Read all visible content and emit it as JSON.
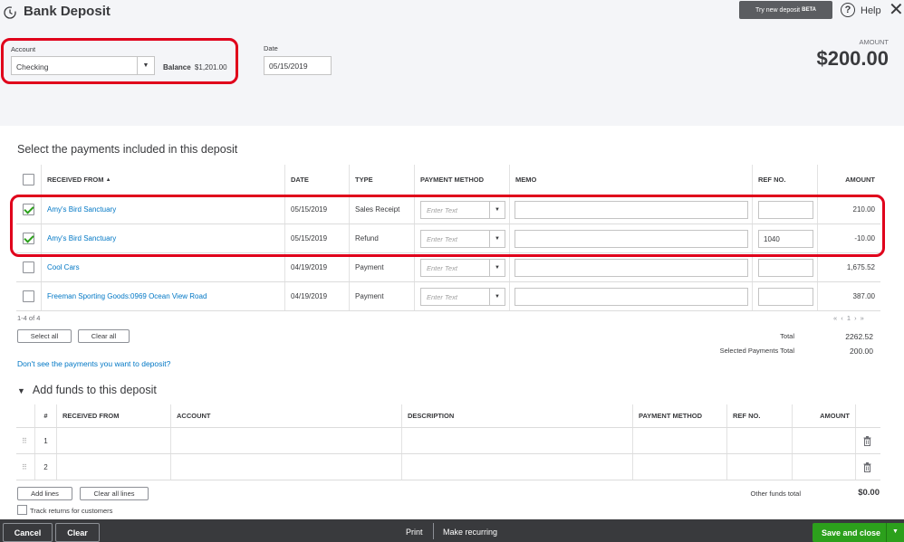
{
  "header": {
    "title": "Bank Deposit",
    "beta_button": "Try new deposit",
    "beta_badge": "BETA",
    "help": "Help",
    "account_label": "Account",
    "account_value": "Checking",
    "balance_label": "Balance",
    "balance_value": "$1,201.00",
    "date_label": "Date",
    "date_value": "05/15/2019",
    "amount_label": "AMOUNT",
    "amount_value": "$200.00"
  },
  "payments": {
    "title": "Select the payments included in this deposit",
    "columns": {
      "received_from": "RECEIVED FROM",
      "sort": "▲",
      "date": "DATE",
      "type": "TYPE",
      "payment_method": "PAYMENT METHOD",
      "memo": "MEMO",
      "ref_no": "REF NO.",
      "amount": "AMOUNT"
    },
    "placeholder": "Enter Text",
    "rows": [
      {
        "name": "Amy's Bird Sanctuary",
        "date": "05/15/2019",
        "type": "Sales Receipt",
        "ref": "",
        "amount": "210.00",
        "checked": true
      },
      {
        "name": "Amy's Bird Sanctuary",
        "date": "05/15/2019",
        "type": "Refund",
        "ref": "1040",
        "amount": "-10.00",
        "checked": true
      },
      {
        "name": "Cool Cars",
        "date": "04/19/2019",
        "type": "Payment",
        "ref": "",
        "amount": "1,675.52",
        "checked": false
      },
      {
        "name": "Freeman Sporting Goods:0969 Ocean View Road",
        "date": "04/19/2019",
        "type": "Payment",
        "ref": "",
        "amount": "387.00",
        "checked": false
      }
    ],
    "count": "1-4 of 4",
    "pager": "« ‹ 1 › »",
    "select_all": "Select all",
    "clear_all": "Clear all",
    "total_label": "Total",
    "total_value": "2262.52",
    "selected_label": "Selected Payments Total",
    "selected_value": "200.00",
    "dont_see": "Don't see the payments you want to deposit?"
  },
  "add_funds": {
    "title": "Add funds to this deposit",
    "columns": {
      "num": "#",
      "received_from": "RECEIVED FROM",
      "account": "ACCOUNT",
      "description": "DESCRIPTION",
      "payment_method": "PAYMENT METHOD",
      "ref_no": "REF NO.",
      "amount": "AMOUNT"
    },
    "rows": [
      {
        "num": "1"
      },
      {
        "num": "2"
      }
    ],
    "add_lines": "Add lines",
    "clear_all_lines": "Clear all lines",
    "other_funds_label": "Other funds total",
    "other_funds_value": "$0.00",
    "track_returns": "Track returns for customers"
  },
  "footer": {
    "cancel": "Cancel",
    "clear": "Clear",
    "print": "Print",
    "make_recurring": "Make recurring",
    "save_close": "Save and close"
  },
  "colors": {
    "accent_green": "#2ca01c",
    "link_blue": "#0077c5",
    "highlight_red": "#e0001b",
    "footer_bg": "#393a3d"
  }
}
